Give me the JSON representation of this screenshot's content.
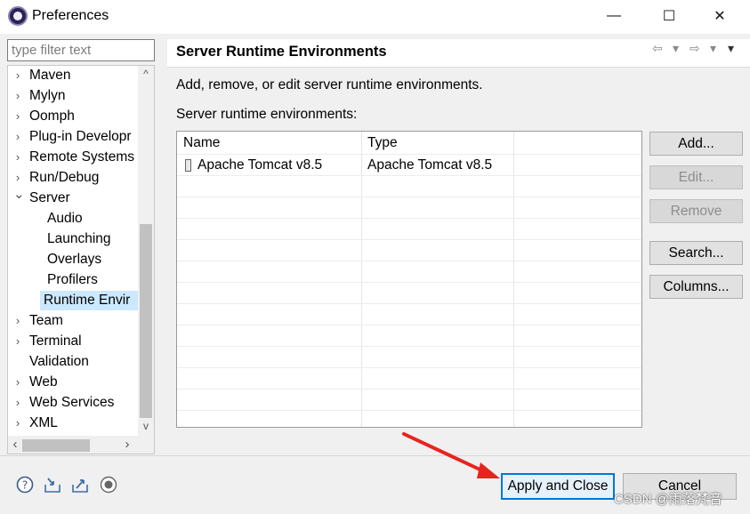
{
  "window": {
    "title": "Preferences",
    "minimize_glyph": "—",
    "maximize_glyph": "☐",
    "close_glyph": "✕"
  },
  "filter": {
    "placeholder": "type filter text"
  },
  "tree": {
    "items": [
      {
        "label": "Maven",
        "chevron": "›",
        "level": 0
      },
      {
        "label": "Mylyn",
        "chevron": "›",
        "level": 0
      },
      {
        "label": "Oomph",
        "chevron": "›",
        "level": 0
      },
      {
        "label": "Plug-in Developr",
        "chevron": "›",
        "level": 0
      },
      {
        "label": "Remote Systems",
        "chevron": "›",
        "level": 0
      },
      {
        "label": "Run/Debug",
        "chevron": "›",
        "level": 0
      },
      {
        "label": "Server",
        "chevron": "⌄",
        "level": 0
      },
      {
        "label": "Audio",
        "chevron": "",
        "level": 1
      },
      {
        "label": "Launching",
        "chevron": "",
        "level": 1
      },
      {
        "label": "Overlays",
        "chevron": "",
        "level": 1
      },
      {
        "label": "Profilers",
        "chevron": "",
        "level": 1
      },
      {
        "label": "Runtime Envir",
        "chevron": "",
        "level": 1,
        "selected": true
      },
      {
        "label": "Team",
        "chevron": "›",
        "level": 0
      },
      {
        "label": "Terminal",
        "chevron": "›",
        "level": 0
      },
      {
        "label": "Validation",
        "chevron": "",
        "level": 0
      },
      {
        "label": "Web",
        "chevron": "›",
        "level": 0
      },
      {
        "label": "Web Services",
        "chevron": "›",
        "level": 0
      },
      {
        "label": "XML",
        "chevron": "›",
        "level": 0
      }
    ],
    "scroll_up": "^",
    "scroll_down": "v",
    "scroll_left": "‹",
    "scroll_right": "›"
  },
  "page": {
    "title": "Server Runtime Environments",
    "description": "Add, remove, or edit server runtime environments.",
    "list_label": "Server runtime environments:",
    "nav": {
      "back": "⇦",
      "back_menu": "▾",
      "forward": "⇨",
      "forward_menu": "▾",
      "view_menu": "▾"
    }
  },
  "table": {
    "columns": [
      "Name",
      "Type"
    ],
    "rows": [
      {
        "name": "Apache Tomcat v8.5",
        "type": "Apache Tomcat v8.5"
      }
    ]
  },
  "buttons": {
    "add": "Add...",
    "edit": "Edit...",
    "remove": "Remove",
    "search": "Search...",
    "columns": "Columns...",
    "apply_close": "Apply and Close",
    "cancel": "Cancel"
  },
  "bottom_icons": [
    "help-icon",
    "import-icon",
    "export-icon",
    "record-icon"
  ],
  "watermark": "CSDN @雨落梵音",
  "colors": {
    "selection": "#cce8ff",
    "accent": "#0078d7",
    "arrow": "#e8231f"
  }
}
